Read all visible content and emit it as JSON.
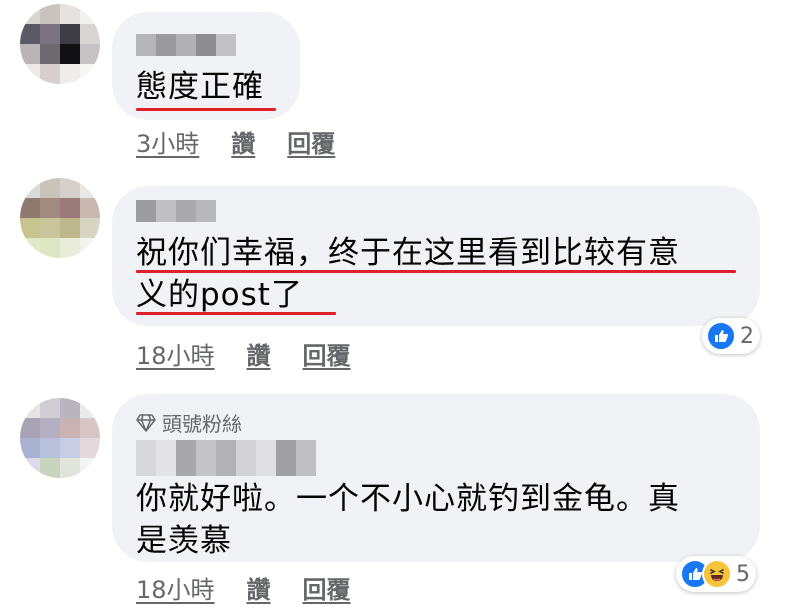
{
  "comments": [
    {
      "text": "態度正確",
      "time": "3小時",
      "like": "讚",
      "reply": "回覆"
    },
    {
      "text": "祝你们幸福，终于在这里看到比较有意\n义的post了",
      "time": "18小時",
      "like": "讚",
      "reply": "回覆",
      "reaction_count": "2",
      "reactions": [
        "like-icon"
      ]
    },
    {
      "badge": "頭號粉絲",
      "text": "你就好啦。一个不小心就钓到金龟。真\n是羡慕",
      "time": "18小時",
      "like": "讚",
      "reply": "回覆",
      "reaction_count": "5",
      "reactions": [
        "like-icon",
        "haha-icon"
      ]
    }
  ],
  "colors": {
    "bubble": "#f0f2f5",
    "underline": "#e0202a",
    "meta": "#65676b",
    "like_blue": "#1877f2"
  }
}
